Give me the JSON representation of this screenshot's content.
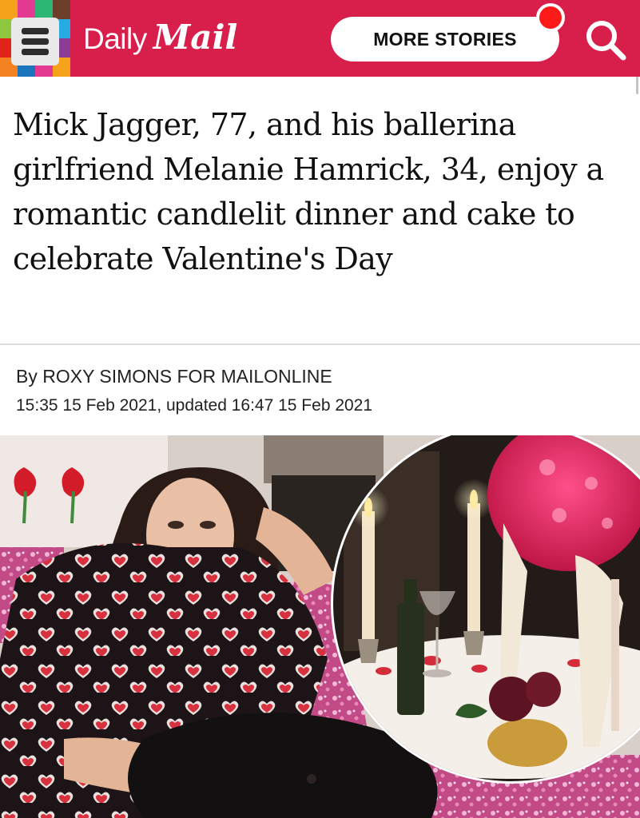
{
  "header": {
    "brand_daily": "Daily",
    "brand_mail": "Mail",
    "more_stories": "MORE STORIES",
    "colors": {
      "bar": "#d81f4b",
      "notification_dot": "#ff1a1a"
    },
    "icons": [
      "menu-icon",
      "notification-dot",
      "search-icon"
    ]
  },
  "article": {
    "headline": "Mick Jagger, 77, and his ballerina girlfriend Melanie Hamrick, 34, enjoy a romantic candlelit dinner and cake to celebrate Valentine's Day",
    "byline": "By ROXY SIMONS FOR MAILONLINE",
    "dateline": "15:35 15 Feb 2021, updated 16:47 15 Feb 2021"
  }
}
